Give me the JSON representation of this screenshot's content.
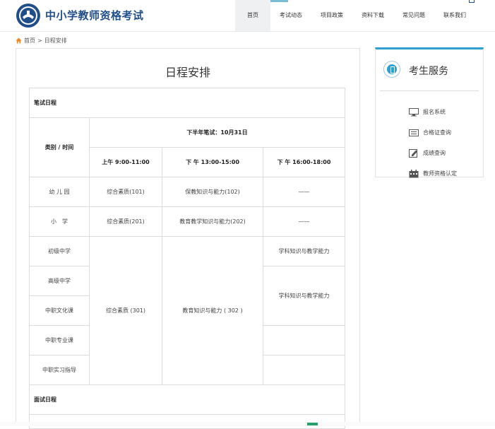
{
  "site": {
    "title": "中小学教师资格考试"
  },
  "nav": [
    {
      "label": "首页"
    },
    {
      "label": "考试动态"
    },
    {
      "label": "项目政策"
    },
    {
      "label": "资料下载"
    },
    {
      "label": "常见问题"
    },
    {
      "label": "联系我们"
    }
  ],
  "breadcrumb": {
    "home": "首页",
    "sep": ">",
    "current": "日程安排"
  },
  "page": {
    "title": "日程安排"
  },
  "schedule": {
    "written_section": "笔试日程",
    "category_time_header": "类别 / 时间",
    "half_header": "下半年笔试：10月31日",
    "slots": [
      "上午 9:00-11:00",
      "下 午 13:00-15:00",
      "下 午 16:00-18:00"
    ],
    "rows": [
      {
        "category": "幼 儿 园",
        "am": "综合素质(101)",
        "pm1": "保教知识与能力(102)",
        "pm2": "——"
      },
      {
        "category": "小　学",
        "am": "综合素质(201)",
        "pm1": "教育教学知识与能力(202)",
        "pm2": "——"
      }
    ],
    "secondary": {
      "categories": [
        "初级中学",
        "高级中学",
        "中职文化课",
        "中职专业课",
        "中职实习指导"
      ],
      "am": "综合素质 (301)",
      "pm1": "教育知识与能力 ( 302 )",
      "pm2_a": "学科知识与教学能力",
      "pm2_b": "学科知识与教学能力"
    },
    "interview_section": "面试日程"
  },
  "sidebar": {
    "title": "考生服务",
    "items": [
      {
        "label": "报名系统",
        "icon": "monitor-icon"
      },
      {
        "label": "合格证查询",
        "icon": "certificate-icon"
      },
      {
        "label": "成绩查询",
        "icon": "edit-icon"
      },
      {
        "label": "教师资格认定",
        "icon": "calendar-icon"
      }
    ]
  },
  "colors": {
    "brand": "#1f4e8a",
    "accent": "#2e9fd4",
    "border": "#dcdcdc"
  }
}
